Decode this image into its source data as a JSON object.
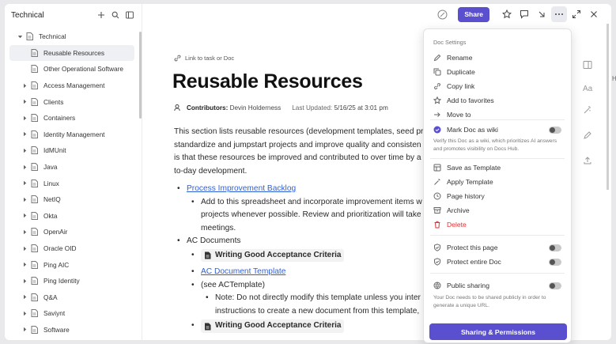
{
  "sidebar": {
    "title": "Technical",
    "items": [
      {
        "label": "Technical",
        "level": 0,
        "expanded": true,
        "chevron": true
      },
      {
        "label": "Reusable Resources",
        "level": 1,
        "selected": true,
        "chevron": false
      },
      {
        "label": "Other Operational Software",
        "level": 1,
        "chevron": false
      },
      {
        "label": "Access Management",
        "level": 1,
        "chevron": true
      },
      {
        "label": "Clients",
        "level": 1,
        "chevron": true
      },
      {
        "label": "Containers",
        "level": 1,
        "chevron": true
      },
      {
        "label": "Identity Management",
        "level": 1,
        "chevron": true
      },
      {
        "label": "IdMUnit",
        "level": 1,
        "chevron": true
      },
      {
        "label": "Java",
        "level": 1,
        "chevron": true
      },
      {
        "label": "Linux",
        "level": 1,
        "chevron": true
      },
      {
        "label": "NetIQ",
        "level": 1,
        "chevron": true
      },
      {
        "label": "Okta",
        "level": 1,
        "chevron": true
      },
      {
        "label": "OpenAir",
        "level": 1,
        "chevron": true
      },
      {
        "label": "Oracle OID",
        "level": 1,
        "chevron": true
      },
      {
        "label": "Ping AIC",
        "level": 1,
        "chevron": true
      },
      {
        "label": "Ping Identity",
        "level": 1,
        "chevron": true
      },
      {
        "label": "Q&A",
        "level": 1,
        "chevron": true
      },
      {
        "label": "Saviynt",
        "level": 1,
        "chevron": true
      },
      {
        "label": "Software",
        "level": 1,
        "chevron": true
      }
    ]
  },
  "topbar": {
    "share_label": "Share"
  },
  "doc": {
    "link_label": "Link to task or Doc",
    "title": "Reusable Resources",
    "contributors_label": "Contributors:",
    "contributors": "Devin Holderness",
    "updated_label": "Last Updated:",
    "updated": "5/16/25 at 3:01 pm",
    "para1_lines": [
      "This section lists reusable resources (development templates, seed pro",
      "standardize and jumpstart projects and improve quality and consisten",
      "is that these resources be improved and contributed to over time by a",
      "to-day development."
    ],
    "bullet1_link": "Process Improvement Backlog",
    "bullet1_sub_lines": [
      "Add to this spreadsheet and incorporate improvement items w",
      "projects whenever possible. Review and prioritization will take",
      "meetings."
    ],
    "bullet2": "AC Documents",
    "chip1": "Writing Good Acceptance Criteria",
    "ac_template_link": "AC Document Template",
    "see_template": "(see ACTemplate)",
    "note_lines": [
      "Note: Do not directly modify this template unless you inter",
      "instructions to create a new document from this template,"
    ],
    "chip2": "Writing Good Acceptance Criteria"
  },
  "menu": {
    "header": "Doc Settings",
    "items1": [
      "Rename",
      "Duplicate",
      "Copy link",
      "Add to favorites",
      "Move to"
    ],
    "wiki_label": "Mark Doc as wiki",
    "wiki_note": "Verify this Doc as a wiki, which prioritizes AI answers and promotes visibility on Docs Hub.",
    "items2": [
      "Save as Template",
      "Apply Template",
      "Page history",
      "Archive"
    ],
    "delete_label": "Delete",
    "protect_page": "Protect this page",
    "protect_doc": "Protect entire Doc",
    "public_sharing": "Public sharing",
    "public_note": "Your Doc needs to be shared publicly in order to generate a unique URL.",
    "perm_button": "Sharing & Permissions"
  },
  "colors": {
    "accent": "#5a4fcf",
    "link": "#2f5fd6",
    "danger": "#d33333"
  }
}
